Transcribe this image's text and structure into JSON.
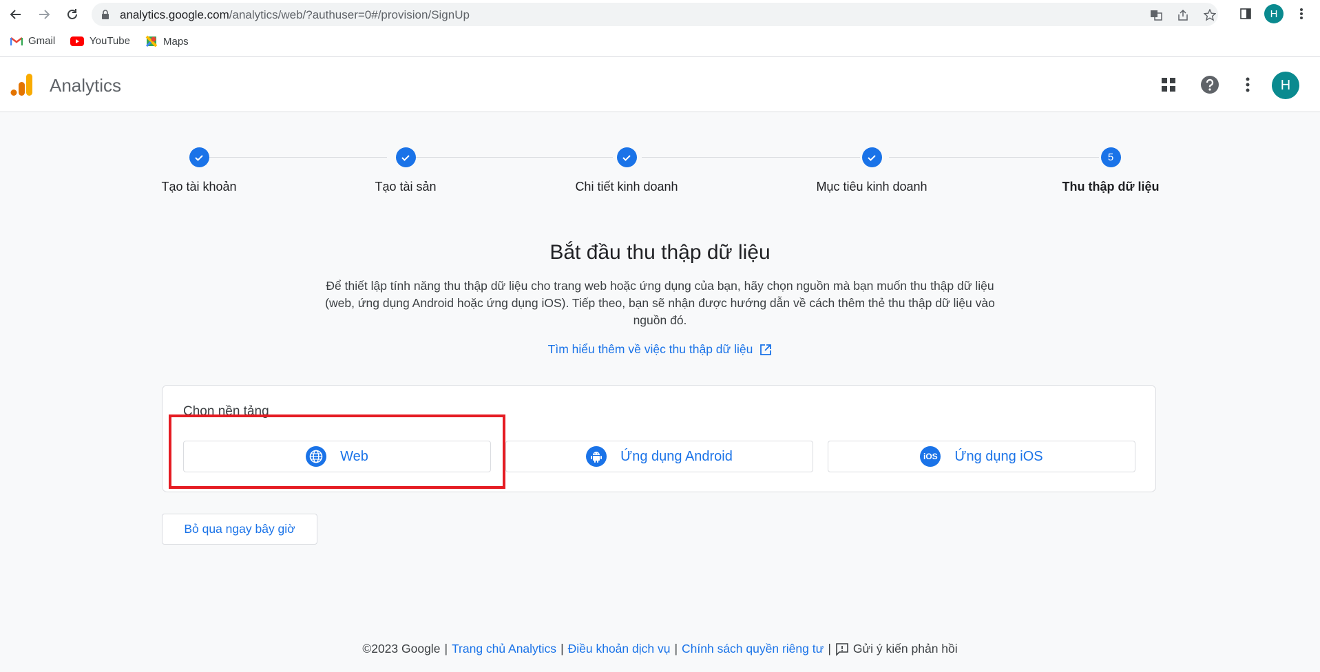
{
  "browser": {
    "url_host": "analytics.google.com",
    "url_rest": "/analytics/web/?authuser=0#/provision/SignUp",
    "profile_initial": "H",
    "bookmarks": [
      {
        "label": "Gmail",
        "icon": "gmail-icon"
      },
      {
        "label": "YouTube",
        "icon": "youtube-icon"
      },
      {
        "label": "Maps",
        "icon": "maps-icon"
      }
    ]
  },
  "header": {
    "app_title": "Analytics",
    "avatar_initial": "H"
  },
  "stepper": {
    "steps": [
      {
        "label": "Tạo tài khoản",
        "state": "done"
      },
      {
        "label": "Tạo tài sản",
        "state": "done"
      },
      {
        "label": "Chi tiết kinh doanh",
        "state": "done"
      },
      {
        "label": "Mục tiêu kinh doanh",
        "state": "done"
      },
      {
        "label": "Thu thập dữ liệu",
        "state": "current",
        "number": "5"
      }
    ]
  },
  "main": {
    "title": "Bắt đầu thu thập dữ liệu",
    "description": "Để thiết lập tính năng thu thập dữ liệu cho trang web hoặc ứng dụng của bạn, hãy chọn nguồn mà bạn muốn thu thập dữ liệu (web, ứng dụng Android hoặc ứng dụng iOS). Tiếp theo, bạn sẽ nhận được hướng dẫn về cách thêm thẻ thu thập dữ liệu vào nguồn đó.",
    "learn_more": "Tìm hiểu thêm về việc thu thập dữ liệu",
    "platform_card_title": "Chọn nền tảng",
    "platforms": [
      {
        "label": "Web",
        "icon": "globe-icon"
      },
      {
        "label": "Ứng dụng Android",
        "icon": "android-icon"
      },
      {
        "label": "Ứng dụng iOS",
        "icon": "ios-icon",
        "icon_text": "iOS"
      }
    ],
    "skip_label": "Bỏ qua ngay bây giờ"
  },
  "footer": {
    "copyright": "©2023 Google",
    "links": [
      "Trang chủ Analytics",
      "Điều khoản dịch vụ",
      "Chính sách quyền riêng tư"
    ],
    "feedback": "Gửi ý kiến phản hồi"
  },
  "colors": {
    "accent": "#1a73e8",
    "highlight": "#e51c23",
    "avatar": "#0a8a8f"
  }
}
